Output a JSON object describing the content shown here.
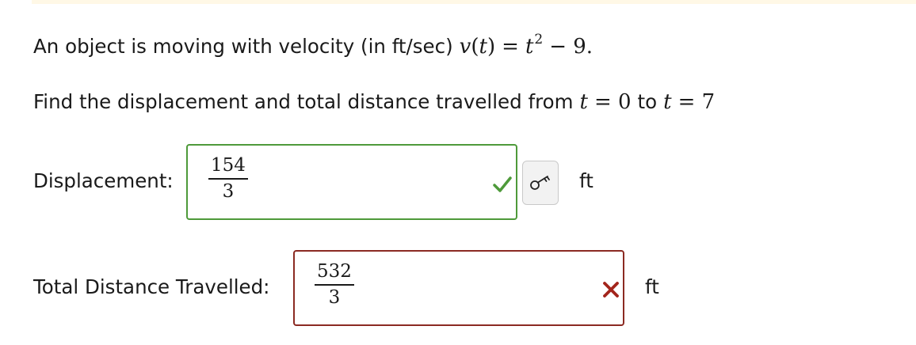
{
  "question": {
    "line1_text": "An object is moving with velocity (in ft/sec)",
    "line1_func": "v",
    "line1_var": "t",
    "line1_rhs_var": "t",
    "line1_exp": "2",
    "line1_rhs_rest": "− 9.",
    "line2_text": "Find the displacement and total distance travelled from",
    "line2_var1": "t",
    "line2_eq1": "= 0",
    "line2_to": "to",
    "line2_var2": "t",
    "line2_eq2": "= 7"
  },
  "displacement": {
    "label": "Displacement:",
    "numerator": "154",
    "denominator": "3",
    "status": "correct",
    "status_icon": "checkmark-icon",
    "unit": "ft",
    "key_icon": "key-icon"
  },
  "total_distance": {
    "label": "Total Distance Travelled:",
    "numerator": "532",
    "denominator": "3",
    "status": "incorrect",
    "status_icon": "cross-icon",
    "unit": "ft"
  },
  "colors": {
    "correct": "#4e9a3a",
    "incorrect": "#8b2a22",
    "top_band": "#fff8e6"
  }
}
